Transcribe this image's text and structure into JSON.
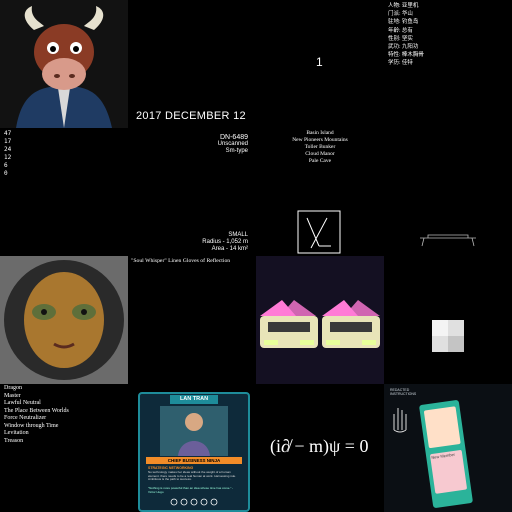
{
  "tile_r0c2": {
    "number": "1"
  },
  "tile_r0c3": {
    "fields": [
      "人物: 亚里机",
      "门派: 华山",
      "驻地: 钓鱼岛",
      "年龄: 总有",
      "性别: 坚实",
      "武功: 九阳功",
      "特性: 棒木胸骨",
      "学历: 佳特"
    ]
  },
  "tile_r0c1_date": "2017 DECEMBER 12",
  "tile_r1c0": {
    "numbers": [
      "47",
      "17",
      "24",
      "12",
      "6",
      "0"
    ]
  },
  "tile_r1c1": {
    "designation": "DN-6489",
    "status": "Unscanned",
    "type": "Sm-type",
    "size": "SMALL",
    "radius": "Radius - 1,052 m",
    "area": "Area - 14 km²"
  },
  "tile_r1c2": {
    "places": [
      "Basin Island",
      "New Pioneers Mountains",
      "Toller Bunker",
      "Cloud Manor",
      "Pale Cave"
    ]
  },
  "tile_r2c1": {
    "item_name": "\"Soul Whisper\" Linen Gloves of Reflection"
  },
  "tile_r3c0": {
    "traits": [
      "Dragon",
      "Master",
      "Lawful Neutral",
      "The Place Between Worlds",
      "Force Neutralizer",
      "Window through Time",
      "Levitation",
      "Treason"
    ]
  },
  "tile_r3c1": {
    "card_name": "LAN TRAN",
    "card_role": "CHIEF BUSINESS NINJA",
    "card_heading": "STRATEGIC NETWORKING",
    "card_body": "No technology makes her ideas without the weight of a human element. there needs to be a real human at work.  Harnessing rule. Ambitious is the path to success.",
    "card_quote": "\"Nothing is more powerful than an idea whose time has come.\" - Victor Hugo"
  },
  "tile_r3c2": {
    "equation": "(i∂̸ − m)ψ = 0"
  },
  "tile_r3c3": {
    "small_label": "REDACTED INSTRUCTIONS",
    "card_title": "New Member"
  },
  "colors": {
    "background": "#000000",
    "text": "#ffffff",
    "card_teal": "#1e8c9a",
    "card_orange": "#f28c28",
    "car_cream": "#e8e4b8",
    "car_pink": "#ff7bd6"
  }
}
